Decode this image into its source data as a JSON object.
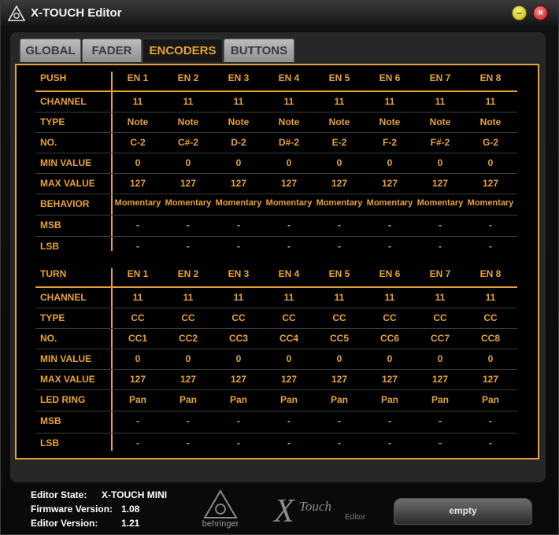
{
  "window": {
    "title": "X-TOUCH Editor",
    "minimize_glyph": "–",
    "close_glyph": "×"
  },
  "tabs": [
    {
      "label": "GLOBAL",
      "active": false
    },
    {
      "label": "FADER",
      "active": false
    },
    {
      "label": "ENCODERS",
      "active": true
    },
    {
      "label": "BUTTONS",
      "active": false
    }
  ],
  "push": {
    "header": "PUSH",
    "columns": [
      "EN 1",
      "EN 2",
      "EN 3",
      "EN 4",
      "EN 5",
      "EN 6",
      "EN 7",
      "EN 8"
    ],
    "rows": [
      {
        "label": "CHANNEL",
        "values": [
          "11",
          "11",
          "11",
          "11",
          "11",
          "11",
          "11",
          "11"
        ]
      },
      {
        "label": "TYPE",
        "values": [
          "Note",
          "Note",
          "Note",
          "Note",
          "Note",
          "Note",
          "Note",
          "Note"
        ]
      },
      {
        "label": "NO.",
        "values": [
          "C-2",
          "C#-2",
          "D-2",
          "D#-2",
          "E-2",
          "F-2",
          "F#-2",
          "G-2"
        ]
      },
      {
        "label": "MIN VALUE",
        "values": [
          "0",
          "0",
          "0",
          "0",
          "0",
          "0",
          "0",
          "0"
        ]
      },
      {
        "label": "MAX VALUE",
        "values": [
          "127",
          "127",
          "127",
          "127",
          "127",
          "127",
          "127",
          "127"
        ]
      },
      {
        "label": "BEHAVIOR",
        "values": [
          "Momentary",
          "Momentary",
          "Momentary",
          "Momentary",
          "Momentary",
          "Momentary",
          "Momentary",
          "Momentary"
        ]
      },
      {
        "label": "MSB",
        "values": [
          "-",
          "-",
          "-",
          "-",
          "-",
          "-",
          "-",
          "-"
        ]
      },
      {
        "label": "LSB",
        "values": [
          "-",
          "-",
          "-",
          "-",
          "-",
          "-",
          "-",
          "-"
        ]
      }
    ]
  },
  "turn": {
    "header": "TURN",
    "columns": [
      "EN 1",
      "EN 2",
      "EN 3",
      "EN 4",
      "EN 5",
      "EN 6",
      "EN 7",
      "EN 8"
    ],
    "rows": [
      {
        "label": "CHANNEL",
        "values": [
          "11",
          "11",
          "11",
          "11",
          "11",
          "11",
          "11",
          "11"
        ]
      },
      {
        "label": "TYPE",
        "values": [
          "CC",
          "CC",
          "CC",
          "CC",
          "CC",
          "CC",
          "CC",
          "CC"
        ]
      },
      {
        "label": "NO.",
        "values": [
          "CC1",
          "CC2",
          "CC3",
          "CC4",
          "CC5",
          "CC6",
          "CC7",
          "CC8"
        ]
      },
      {
        "label": "MIN VALUE",
        "values": [
          "0",
          "0",
          "0",
          "0",
          "0",
          "0",
          "0",
          "0"
        ]
      },
      {
        "label": "MAX VALUE",
        "values": [
          "127",
          "127",
          "127",
          "127",
          "127",
          "127",
          "127",
          "127"
        ]
      },
      {
        "label": "LED RING",
        "values": [
          "Pan",
          "Pan",
          "Pan",
          "Pan",
          "Pan",
          "Pan",
          "Pan",
          "Pan"
        ]
      },
      {
        "label": "MSB",
        "values": [
          "-",
          "-",
          "-",
          "-",
          "-",
          "-",
          "-",
          "-"
        ]
      },
      {
        "label": "LSB",
        "values": [
          "-",
          "-",
          "-",
          "-",
          "-",
          "-",
          "-",
          "-"
        ]
      }
    ]
  },
  "status": {
    "editor_state_label": "Editor State:",
    "editor_state_value": "X-TOUCH MINI",
    "firmware_label": "Firmware Version:",
    "firmware_value": "1.08",
    "editor_version_label": "Editor Version:",
    "editor_version_value": "1.21"
  },
  "brand": {
    "behringer": "behringer",
    "x_letter": "X",
    "touch_word": "Touch",
    "editor_word": "Editor"
  },
  "preset_button": "empty",
  "colors": {
    "accent": "#e8a233",
    "panel": "#272727",
    "grid": "#3a3a3a",
    "tab_inactive": "#bdbdbd"
  }
}
